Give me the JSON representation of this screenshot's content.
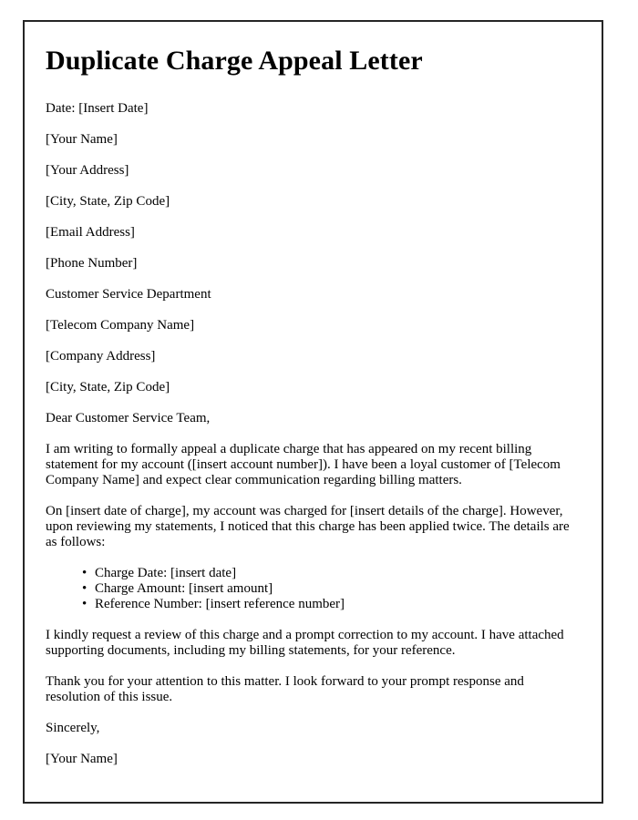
{
  "document": {
    "title": "Duplicate Charge Appeal Letter",
    "date_line": "Date: [Insert Date]",
    "sender": {
      "name": "[Your Name]",
      "address": "[Your Address]",
      "city_state_zip": "[City, State, Zip Code]",
      "email": "[Email Address]",
      "phone": "[Phone Number]"
    },
    "recipient": {
      "department": "Customer Service Department",
      "company": "[Telecom Company Name]",
      "address": "[Company Address]",
      "city_state_zip": "[City, State, Zip Code]"
    },
    "salutation": "Dear Customer Service Team,",
    "body": {
      "paragraph_1": "I am writing to formally appeal a duplicate charge that has appeared on my recent billing statement for my account ([insert account number]). I have been a loyal customer of [Telecom Company Name] and expect clear communication regarding billing matters.",
      "paragraph_2": "On [insert date of charge], my account was charged for [insert details of the charge]. However, upon reviewing my statements, I noticed that this charge has been applied twice. The details are as follows:",
      "details": [
        "Charge Date: [insert date]",
        "Charge Amount: [insert amount]",
        "Reference Number: [insert reference number]"
      ],
      "paragraph_3": "I kindly request a review of this charge and a prompt correction to my account. I have attached supporting documents, including my billing statements, for your reference.",
      "paragraph_4": "Thank you for your attention to this matter. I look forward to your prompt response and resolution of this issue."
    },
    "closing": "Sincerely,",
    "signature_name": "[Your Name]"
  },
  "style": {
    "border_color": "#252525",
    "text_color": "#000000",
    "background": "#ffffff"
  }
}
